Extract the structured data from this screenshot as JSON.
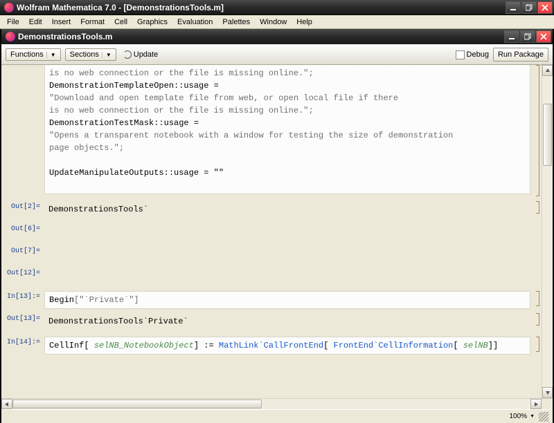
{
  "app": {
    "title": "Wolfram Mathematica 7.0 - [DemonstrationsTools.m]",
    "doc_title": "DemonstrationsTools.m"
  },
  "menu": {
    "file": "File",
    "edit": "Edit",
    "insert": "Insert",
    "format": "Format",
    "cell": "Cell",
    "graphics": "Graphics",
    "evaluation": "Evaluation",
    "palettes": "Palettes",
    "window": "Window",
    "help": "Help"
  },
  "toolbar": {
    "functions": "Functions",
    "sections": "Sections",
    "update": "Update",
    "debug": "Debug",
    "run": "Run Package"
  },
  "cells": {
    "top_partial": "is no web connection or the file is missing online.\";",
    "open_usage_lhs": "DemonstrationTemplateOpen::usage =",
    "open_usage_txt": "\"Download and open template file from web, or open local file if there",
    "open_usage_txt2": "is no web connection or the file is missing online.\";",
    "mask_usage_lhs": "DemonstrationTestMask::usage =",
    "mask_usage_txt": "\"Opens a transparent notebook with a window for testing the size of demonstration",
    "mask_usage_txt2": "page objects.\";",
    "update_usage": "UpdateManipulateOutputs::usage = \"\"",
    "out2_label": "Out[2]=",
    "out2_val": "DemonstrationsTools`",
    "out6_label": "Out[6]=",
    "out7_label": "Out[7]=",
    "out12_label": "Out[12]=",
    "in13_label": "In[13]:=",
    "in13_begin": "Begin",
    "in13_arg": "[\"`Private`\"]",
    "out13_label": "Out[13]=",
    "out13_val": "DemonstrationsTools`Private`",
    "in14_label": "In[14]:=",
    "in14_fn": "CellInf",
    "in14_pat": "selNB_NotebookObject",
    "in14_setdelayed": " := ",
    "in14_ml": "MathLink`CallFrontEnd",
    "in14_fe": "FrontEnd`CellInformation",
    "in14_arg": "selNB"
  },
  "status": {
    "zoom": "100%"
  }
}
